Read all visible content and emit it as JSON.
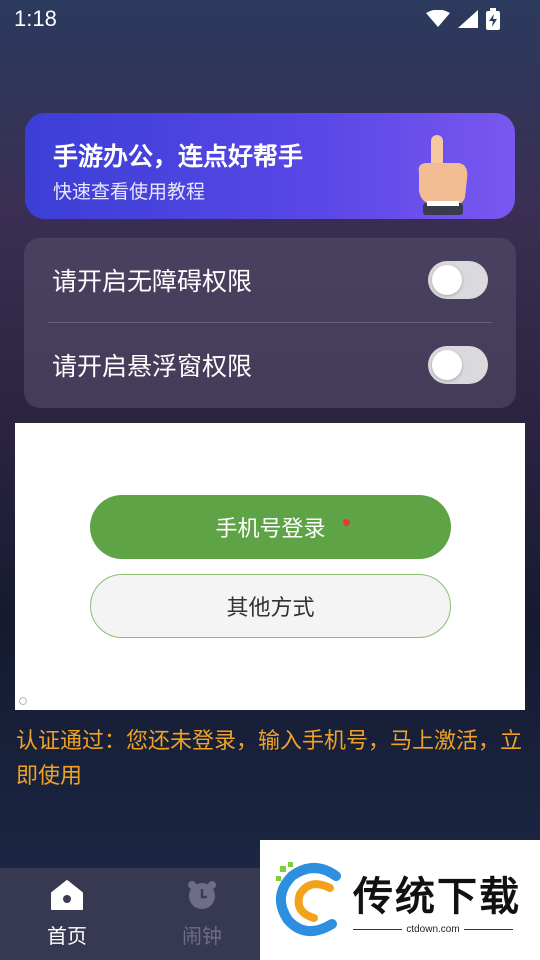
{
  "status_bar": {
    "time": "1:18",
    "icons": [
      "wifi-icon",
      "signal-icon",
      "battery-charging-icon"
    ]
  },
  "banner": {
    "title": "手游办公，连点好帮手",
    "subtitle": "快速查看使用教程",
    "icon": "pointing-hand-icon"
  },
  "permissions": [
    {
      "label": "请开启无障碍权限",
      "enabled": false
    },
    {
      "label": "请开启悬浮窗权限",
      "enabled": false
    }
  ],
  "login": {
    "phone_button": "手机号登录",
    "other_button": "其他方式"
  },
  "auth_message": "认证通过：您还未登录，输入手机号，马上激活，立即使用",
  "bottom_nav": [
    {
      "label": "首页",
      "icon": "home-icon",
      "active": true
    },
    {
      "label": "闹钟",
      "icon": "alarm-clock-icon",
      "active": false
    }
  ],
  "watermark": {
    "brand": "传统下载",
    "url": "ctdown.com"
  },
  "colors": {
    "accent_green": "#5ea446",
    "warning_orange": "#f0a224",
    "banner_purple": "#5a47e6"
  }
}
